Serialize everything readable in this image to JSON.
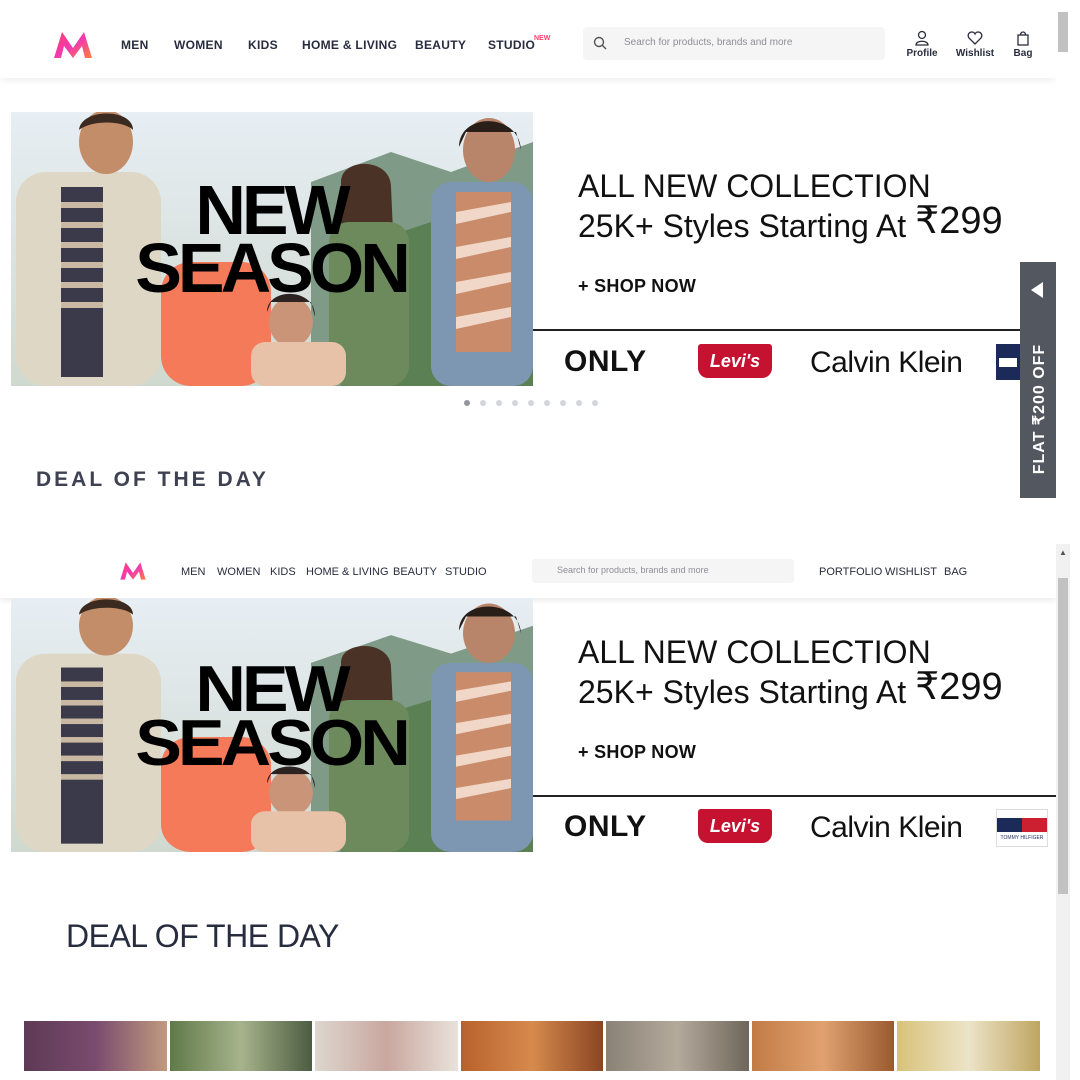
{
  "header": {
    "nav": [
      "MEN",
      "WOMEN",
      "KIDS",
      "HOME & LIVING",
      "BEAUTY",
      "STUDIO"
    ],
    "studio_badge": "NEW",
    "search_placeholder": "Search for products, brands and more",
    "actions": [
      "Profile",
      "Wishlist",
      "Bag"
    ]
  },
  "banner": {
    "image_headline_1": "NEW",
    "image_headline_2": "SEASON",
    "title_line1": "ALL NEW COLLECTION",
    "title_line2": "25K+ Styles Starting At ",
    "price": "₹299",
    "cta": "+ SHOP NOW",
    "brands": [
      "ONLY",
      "Levi's",
      "Calvin Klein",
      "TOMMY HILFIGER"
    ],
    "carousel_total": 9,
    "carousel_active": 1
  },
  "promo_tab": {
    "label": "FLAT ₹200 OFF"
  },
  "section_title": "DEAL OF THE DAY",
  "recreation": {
    "nav": [
      "MEN",
      "WOMEN",
      "KIDS",
      "HOME & LIVING",
      "BEAUTY",
      "STUDIO"
    ],
    "search_placeholder": "Search for products, brands and more",
    "actions": [
      "PORTFOLIO",
      "WISHLIST",
      "BAG"
    ],
    "section_title": "DEAL OF THE DAY"
  },
  "colors": {
    "brand_pink": "#ff3f6c",
    "levis_red": "#c41230",
    "tab_gray": "#53575f"
  }
}
